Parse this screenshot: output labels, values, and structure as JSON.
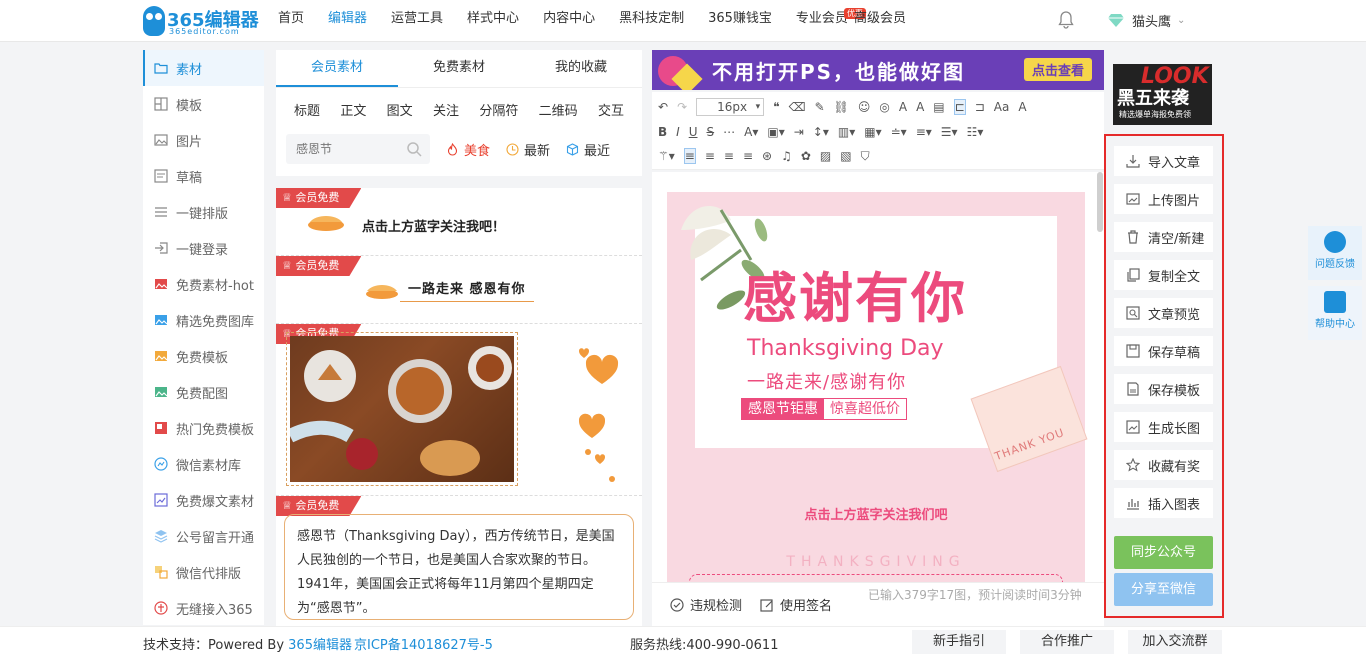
{
  "header": {
    "logo_brand": "365编辑器",
    "logo_sub": "365editor.com",
    "nav": [
      {
        "label": "首页",
        "active": false
      },
      {
        "label": "编辑器",
        "active": true
      },
      {
        "label": "运营工具",
        "active": false
      },
      {
        "label": "样式中心",
        "active": false
      },
      {
        "label": "内容中心",
        "active": false
      },
      {
        "label": "黑科技定制",
        "active": false
      },
      {
        "label": "365赚钱宝",
        "active": false
      },
      {
        "label": "专业会员",
        "active": false,
        "badge": "优惠"
      },
      {
        "label": "高级会员",
        "active": false
      }
    ],
    "username": "猫头鹰"
  },
  "sidebar": {
    "items": [
      {
        "label": "素材",
        "icon": "folder-icon",
        "active": true
      },
      {
        "label": "模板",
        "icon": "layout-icon"
      },
      {
        "label": "图片",
        "icon": "image-icon"
      },
      {
        "label": "草稿",
        "icon": "draft-icon"
      },
      {
        "label": "一键排版",
        "icon": "list-icon"
      },
      {
        "label": "一键登录",
        "icon": "login-icon"
      },
      {
        "label": "免费素材-hot",
        "icon": "hot-image-icon"
      },
      {
        "label": "精选免费图库",
        "icon": "gallery-icon"
      },
      {
        "label": "免费模板",
        "icon": "template-icon"
      },
      {
        "label": "免费配图",
        "icon": "picture-icon"
      },
      {
        "label": "热门免费模板",
        "icon": "hot-template-icon"
      },
      {
        "label": "微信素材库",
        "icon": "wechat-library-icon"
      },
      {
        "label": "免费爆文素材",
        "icon": "chart-icon"
      },
      {
        "label": "公号留言开通",
        "icon": "layers-icon"
      },
      {
        "label": "微信代排版",
        "icon": "typeset-icon"
      },
      {
        "label": "无缝接入365",
        "icon": "connect-icon"
      }
    ]
  },
  "library": {
    "tabs": [
      "会员素材",
      "免费素材",
      "我的收藏"
    ],
    "active_tab": 0,
    "categories": [
      "标题",
      "正文",
      "图文",
      "关注",
      "分隔符",
      "二维码",
      "交互"
    ],
    "search_placeholder": "感恩节",
    "filters": [
      "美食",
      "最新",
      "最近"
    ],
    "ribbon": "会员免费",
    "card1_text": "点击上方蓝字关注我吧！",
    "card2_text": "一路走来 感恩有你",
    "card4_text": "感恩节（Thanksgiving Day），西方传统节日，是美国人民独创的一个节日，也是美国人合家欢聚的节日。1941年，美国国会正式将每年11月第四个星期四定为“感恩节”。"
  },
  "banner": {
    "text": "不用打开PS，也能做好图",
    "cta": "点击查看"
  },
  "toolbar": {
    "font_size": "16px"
  },
  "canvas": {
    "title": "感谢有你",
    "en_title": "Thanksgiving Day",
    "subtitle": "一路走来/感谢有你",
    "tag1": "感恩节钜惠",
    "tag2": "惊喜超低价",
    "envelope_text": "THANK YOU",
    "follow_text": "点击上方蓝字关注我们吧",
    "thanks_text": "THANKSGIVING"
  },
  "statusbar": {
    "check": "违规检测",
    "signature": "使用签名",
    "count": "已输入379字17图，预计阅读时间3分钟"
  },
  "ad": {
    "look": "LOOK",
    "title": "黑五来袭",
    "sub": "精选爆单海报免费领"
  },
  "actions": {
    "buttons": [
      {
        "label": "导入文章",
        "icon": "import-icon"
      },
      {
        "label": "上传图片",
        "icon": "upload-image-icon"
      },
      {
        "label": "清空/新建",
        "icon": "trash-icon"
      },
      {
        "label": "复制全文",
        "icon": "copy-icon"
      },
      {
        "label": "文章预览",
        "icon": "preview-icon"
      },
      {
        "label": "保存草稿",
        "icon": "save-icon"
      },
      {
        "label": "保存模板",
        "icon": "save-template-icon"
      },
      {
        "label": "生成长图",
        "icon": "long-image-icon"
      },
      {
        "label": "收藏有奖",
        "icon": "star-icon"
      },
      {
        "label": "插入图表",
        "icon": "bar-chart-icon"
      }
    ],
    "sync": "同步公众号",
    "share": "分享至微信",
    "sync_color": "#7ac25c",
    "share_color": "#8fc3f0"
  },
  "float": {
    "feedback": "问题反馈",
    "help": "帮助中心"
  },
  "footer": {
    "support_prefix": "技术支持：Powered By ",
    "support_link": "365编辑器",
    "icp": "京ICP备14018627号-5",
    "hotline": "服务热线:400-990-0611",
    "buttons": [
      "新手指引",
      "合作推广",
      "加入交流群"
    ]
  }
}
